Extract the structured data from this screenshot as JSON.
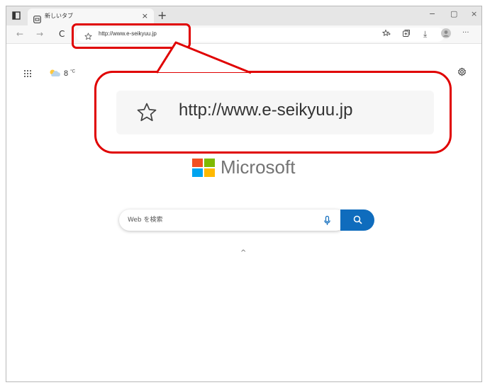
{
  "tab": {
    "title": "新しいタブ",
    "close": "×"
  },
  "new_tab": "+",
  "window": {
    "minimize": "−",
    "maximize": "▢",
    "close": "×"
  },
  "toolbar": {
    "back": "←",
    "forward": "→",
    "refresh": "C",
    "url": "http://www.e-seikyuu.jp",
    "download": "⤓",
    "more": "···"
  },
  "weather": {
    "temperature": "8",
    "unit": "°C"
  },
  "logo": {
    "text": "Microsoft"
  },
  "search": {
    "placeholder": "Web を検索"
  },
  "collapse": "^",
  "callout": {
    "url": "http://www.e-seikyuu.jp"
  },
  "colors": {
    "highlight": "#e00000",
    "search_button": "#0f6cbd",
    "logo_red": "#f25022",
    "logo_green": "#7fba00",
    "logo_blue": "#00a4ef",
    "logo_yellow": "#ffb900"
  }
}
